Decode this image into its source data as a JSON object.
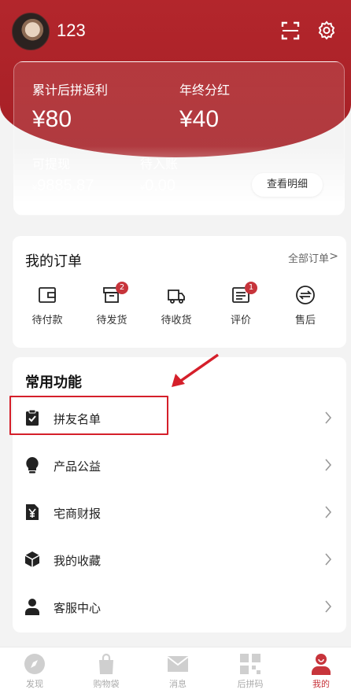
{
  "user": {
    "name": "123"
  },
  "header_icons": {
    "scan": "scan-icon",
    "settings": "gear-icon"
  },
  "earnings": {
    "cumulative_label": "累计后拼返利",
    "cumulative_value": "¥80",
    "year_end_label": "年终分红",
    "year_end_value": "¥40",
    "withdrawable_label": "可提现",
    "withdrawable_currency": "¥",
    "withdrawable_value": "9885.87",
    "pending_label": "待入账",
    "pending_currency": "¥",
    "pending_value": "0.00",
    "detail_button": "查看明细"
  },
  "orders": {
    "title": "我的订单",
    "all_label": "全部订单",
    "items": [
      {
        "label": "待付款",
        "icon": "wallet-icon",
        "badge": ""
      },
      {
        "label": "待发货",
        "icon": "box-icon",
        "badge": "2"
      },
      {
        "label": "待收货",
        "icon": "truck-icon",
        "badge": ""
      },
      {
        "label": "评价",
        "icon": "comment-icon",
        "badge": "1"
      },
      {
        "label": "售后",
        "icon": "exchange-icon",
        "badge": ""
      }
    ]
  },
  "features": {
    "title": "常用功能",
    "items": [
      {
        "label": "拼友名单",
        "icon": "clipboard-check-icon"
      },
      {
        "label": "产品公益",
        "icon": "lightbulb-icon"
      },
      {
        "label": "宅商财报",
        "icon": "yen-document-icon"
      },
      {
        "label": "我的收藏",
        "icon": "cube-icon"
      },
      {
        "label": "客服中心",
        "icon": "person-icon"
      }
    ]
  },
  "tabs": [
    {
      "label": "发现",
      "icon": "compass-icon",
      "active": false
    },
    {
      "label": "购物袋",
      "icon": "shopping-bag-icon",
      "active": false
    },
    {
      "label": "消息",
      "icon": "mail-icon",
      "active": false
    },
    {
      "label": "后拼码",
      "icon": "qr-code-icon",
      "active": false
    },
    {
      "label": "我的",
      "icon": "user-icon",
      "active": true
    }
  ],
  "colors": {
    "brand": "#b3262c",
    "highlight": "#d51f2a",
    "badge": "#c7343b"
  }
}
